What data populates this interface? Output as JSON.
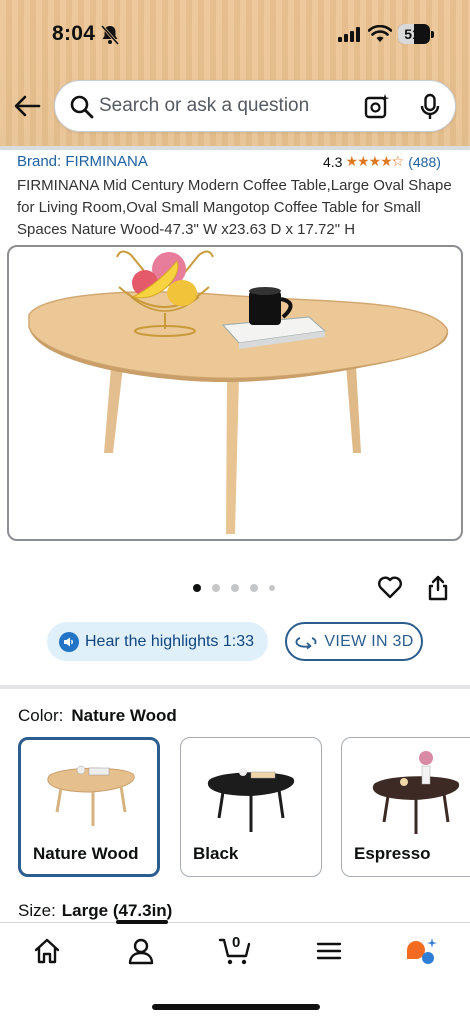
{
  "status_bar": {
    "time": "8:04",
    "battery": "51"
  },
  "search": {
    "placeholder": "Search or ask a question"
  },
  "product": {
    "brand": "Brand: FIRMINANA",
    "rating_value": "4.3",
    "rating_stars": 4.3,
    "rating_count": "(488)",
    "title": "FIRMINANA Mid Century Modern Coffee Table,Large Oval Shape for Living Room,Oval Small Mangotop Coffee Table for Small Spaces Nature Wood-47.3\" W x23.63 D x 17.72\" H"
  },
  "gallery": {
    "image_count": 5,
    "active_index": 0
  },
  "actions": {
    "highlights_label": "Hear the highlights 1:33",
    "view3d_label": "VIEW IN 3D"
  },
  "color": {
    "label": "Color:",
    "selected": "Nature Wood",
    "options": [
      {
        "label": "Nature Wood",
        "tone": "#d9b07c",
        "selected": true
      },
      {
        "label": "Black",
        "tone": "#1c1c1c",
        "selected": false
      },
      {
        "label": "Espresso",
        "tone": "#3e2a24",
        "selected": false
      }
    ]
  },
  "size": {
    "label": "Size:",
    "value": "Large",
    "detail": "(47.3in)"
  },
  "nav": {
    "cart_count": "0",
    "items": [
      "home-icon",
      "account-icon",
      "cart-icon",
      "menu-icon",
      "rufus-icon"
    ]
  },
  "colors": {
    "link": "#2162a1",
    "star": "#de7921",
    "selected_border": "#2c5d8f",
    "header_bg": "#ecc392"
  }
}
